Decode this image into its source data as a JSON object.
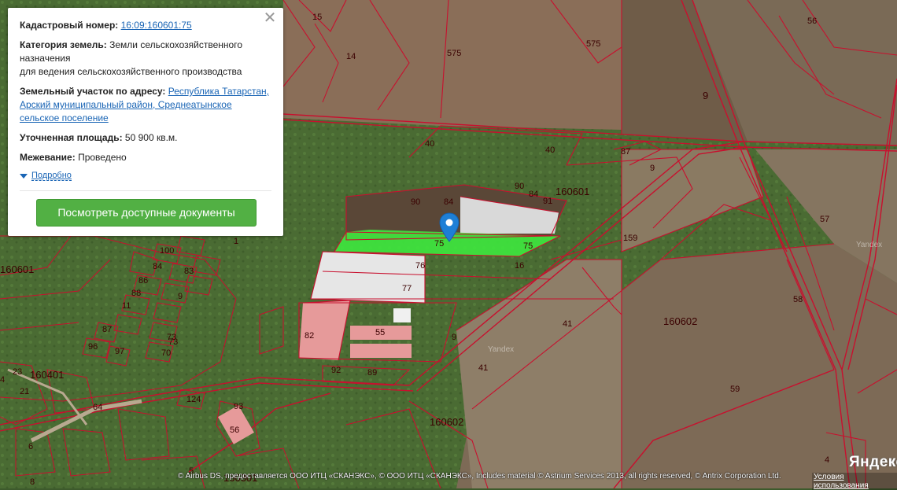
{
  "popup": {
    "cad_label": "Кадастровый номер:",
    "cad_value": "16:09:160601:75",
    "cat_label": "Категория земель:",
    "cat_value_1": " Земли сельскохозяйственного назначения",
    "cat_value_2": "для ведения сельскохозяйственного производства",
    "addr_label": "Земельный участок по адресу:",
    "addr_value": "Республика Татарстан, Арский муниципальный район, Среднеатынское сельское поселение",
    "area_label": "Уточненная площадь:",
    "area_value": " 50 900 кв.м.",
    "survey_label": "Межевание:",
    "survey_value": " Проведено",
    "more_label": "Подробно",
    "docs_button": "Посмотреть доступные документы",
    "close_icon": "close-icon"
  },
  "map": {
    "plot_labels": [
      "15",
      "14",
      "575",
      "575",
      "56",
      "9",
      "40",
      "40",
      "87",
      "9",
      "90",
      "84",
      "90",
      "84",
      "91",
      "160601",
      "75",
      "75",
      "76",
      "77",
      "16",
      "159",
      "57",
      "58",
      "41",
      "160602",
      "55",
      "9",
      "41",
      "92",
      "89",
      "82",
      "59",
      "160602",
      "4",
      "160401",
      "124",
      "93",
      "56",
      "64",
      "6",
      "8",
      "160301",
      "160601",
      "100",
      "84",
      "83",
      "86",
      "88",
      "9",
      "11",
      "87",
      "96",
      "97",
      "73",
      "70",
      "1",
      "23",
      "21",
      "5",
      "4",
      "73"
    ],
    "watermark": "Yandex",
    "logo": "Яндекс",
    "copyright": "© Airbus DS, предоставляется ООО ИТЦ «СКАНЭКС», © ООО ИТЦ «СКАНЭКС», Includes material © Astrium Services 2013, all rights reserved, © Antrix Corporation Ltd.",
    "terms_link": "Условия использования",
    "pin_icon": "map-pin-icon",
    "colors": {
      "border": "#c8102e",
      "selected": "#3ee83e",
      "pin": "#1e7fd6"
    }
  }
}
